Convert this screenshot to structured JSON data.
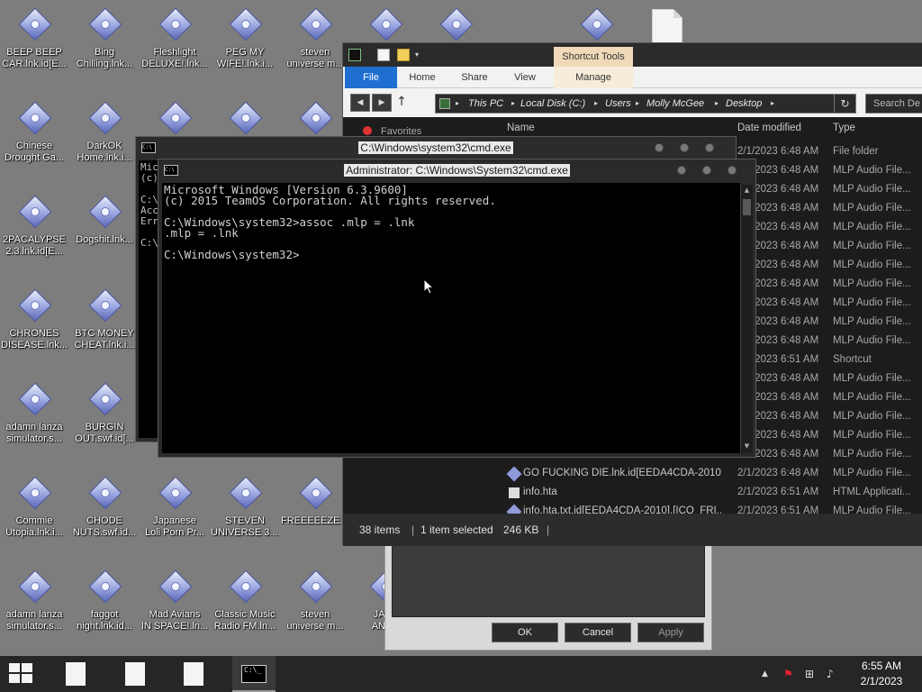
{
  "desktop": {
    "icons": [
      {
        "label1": "BEEP BEEP",
        "label2": "CAR.lnk.id[E..."
      },
      {
        "label1": "Bing",
        "label2": "Chilling.lnk..."
      },
      {
        "label1": "Fleshlight",
        "label2": "DELUXE!.lnk..."
      },
      {
        "label1": "PEG MY",
        "label2": "WIFE!.lnk.i..."
      },
      {
        "label1": "steven",
        "label2": "universe m..."
      },
      {
        "label1": "Chinese",
        "label2": "Drought Ga..."
      },
      {
        "label1": "DarkOK",
        "label2": "Home.lnk.i..."
      },
      {
        "label1": "2PACALYPSE",
        "label2": "2.3.lnk.id[E..."
      },
      {
        "label1": "Dogshit.lnk...",
        "label2": ""
      },
      {
        "label1": "CHRONES",
        "label2": "DISEASE.lnk..."
      },
      {
        "label1": "BTC MONEY",
        "label2": "CHEAT.lnk.i..."
      },
      {
        "label1": "adamn lanza",
        "label2": "simulator.s..."
      },
      {
        "label1": "BURGIN",
        "label2": "OUT.swf.id[..."
      },
      {
        "label1": "Commie",
        "label2": "Utopia.lnk.i..."
      },
      {
        "label1": "CHODE",
        "label2": "NUTS.swf.id..."
      },
      {
        "label1": "Japanese",
        "label2": "Loli Porn Pr..."
      },
      {
        "label1": "STEVEN",
        "label2": "UNIVERSE 3...."
      },
      {
        "label1": "FREEEEEZE.s...",
        "label2": ""
      },
      {
        "label1": "adamn lanza",
        "label2": "simulator.s..."
      },
      {
        "label1": "faggot",
        "label2": "night.lnk.id..."
      },
      {
        "label1": "Mad Avians",
        "label2": "IN SPACE!.ln..."
      },
      {
        "label1": "Classic Music",
        "label2": "Radio FM.ln..."
      },
      {
        "label1": "steven",
        "label2": "universe m..."
      },
      {
        "label1": "JAPA",
        "label2": "ANIMI"
      }
    ]
  },
  "properties_dialog": {
    "ok_label": "OK",
    "cancel_label": "Cancel",
    "apply_label": "Apply"
  },
  "explorer": {
    "contextual_tab": "Shortcut Tools",
    "tabs": [
      "File",
      "Home",
      "Share",
      "View",
      "Manage"
    ],
    "breadcrumb": [
      "This PC",
      "Local Disk (C:)",
      "Users",
      "Molly McGee",
      "Desktop"
    ],
    "search_placeholder": "Search De",
    "columns": {
      "name": "Name",
      "date": "Date modified",
      "type": "Type"
    },
    "nav_label": "Favorites",
    "rows": [
      {
        "name": "",
        "date": "2/1/2023 6:48 AM",
        "type": "File folder"
      },
      {
        "name": "",
        "date": "2/1/2023 6:48 AM",
        "type": "MLP Audio File..."
      },
      {
        "name": "",
        "date": "2/1/2023 6:48 AM",
        "type": "MLP Audio File..."
      },
      {
        "name": "",
        "date": "2/1/2023 6:48 AM",
        "type": "MLP Audio File..."
      },
      {
        "name": "",
        "date": "2/1/2023 6:48 AM",
        "type": "MLP Audio File..."
      },
      {
        "name": "",
        "date": "2/1/2023 6:48 AM",
        "type": "MLP Audio File..."
      },
      {
        "name": "",
        "date": "2/1/2023 6:48 AM",
        "type": "MLP Audio File..."
      },
      {
        "name": "",
        "date": "2/1/2023 6:48 AM",
        "type": "MLP Audio File..."
      },
      {
        "name": "",
        "date": "2/1/2023 6:48 AM",
        "type": "MLP Audio File..."
      },
      {
        "name": "",
        "date": "2/1/2023 6:48 AM",
        "type": "MLP Audio File..."
      },
      {
        "name": "",
        "date": "2/1/2023 6:48 AM",
        "type": "MLP Audio File..."
      },
      {
        "name": "",
        "date": "2/1/2023 6:51 AM",
        "type": "Shortcut"
      },
      {
        "name": "",
        "date": "2/1/2023 6:48 AM",
        "type": "MLP Audio File..."
      },
      {
        "name": "",
        "date": "2/1/2023 6:48 AM",
        "type": "MLP Audio File..."
      },
      {
        "name": "",
        "date": "2/1/2023 6:48 AM",
        "type": "MLP Audio File..."
      },
      {
        "name": "",
        "date": "2/1/2023 6:48 AM",
        "type": "MLP Audio File..."
      },
      {
        "name": "",
        "date": "2/1/2023 6:48 AM",
        "type": "MLP Audio File..."
      },
      {
        "name": "GO FUCKING DIE.lnk.id[EEDA4CDA-2010]...",
        "date": "2/1/2023 6:48 AM",
        "type": "MLP Audio File..."
      },
      {
        "name": "info.hta",
        "date": "2/1/2023 6:51 AM",
        "type": "HTML Applicati..."
      },
      {
        "name": "info.hta.txt.id[EEDA4CDA-2010].[ICQ_FRI...",
        "date": "2/1/2023 6:51 AM",
        "type": "MLP Audio File..."
      }
    ],
    "status_items": "38 items",
    "status_selected": "1 item selected",
    "status_size": "246 KB"
  },
  "cmd_back": {
    "title": "C:\\Windows\\system32\\cmd.exe",
    "lines": [
      "Mic",
      "(c)",
      "",
      "C:\\",
      "Acc",
      "Err",
      "",
      "C:\\"
    ]
  },
  "cmd_front": {
    "title": "Administrator: C:\\Windows\\System32\\cmd.exe",
    "output": "Microsoft Windows [Version 6.3.9600]\n(c) 2015 TeamOS Corporation. All rights reserved.\n\nC:\\Windows\\system32>assoc .mlp = .lnk\n.mlp = .lnk\n\nC:\\Windows\\system32>"
  },
  "taskbar": {
    "time": "6:55 AM",
    "date": "2/1/2023",
    "cmd_icon_text": "C:\\_"
  },
  "colors": {
    "desktop": "#7d7d7d",
    "file_tab": "#1f6fd1",
    "contextual_tab": "#f0d9b9"
  }
}
